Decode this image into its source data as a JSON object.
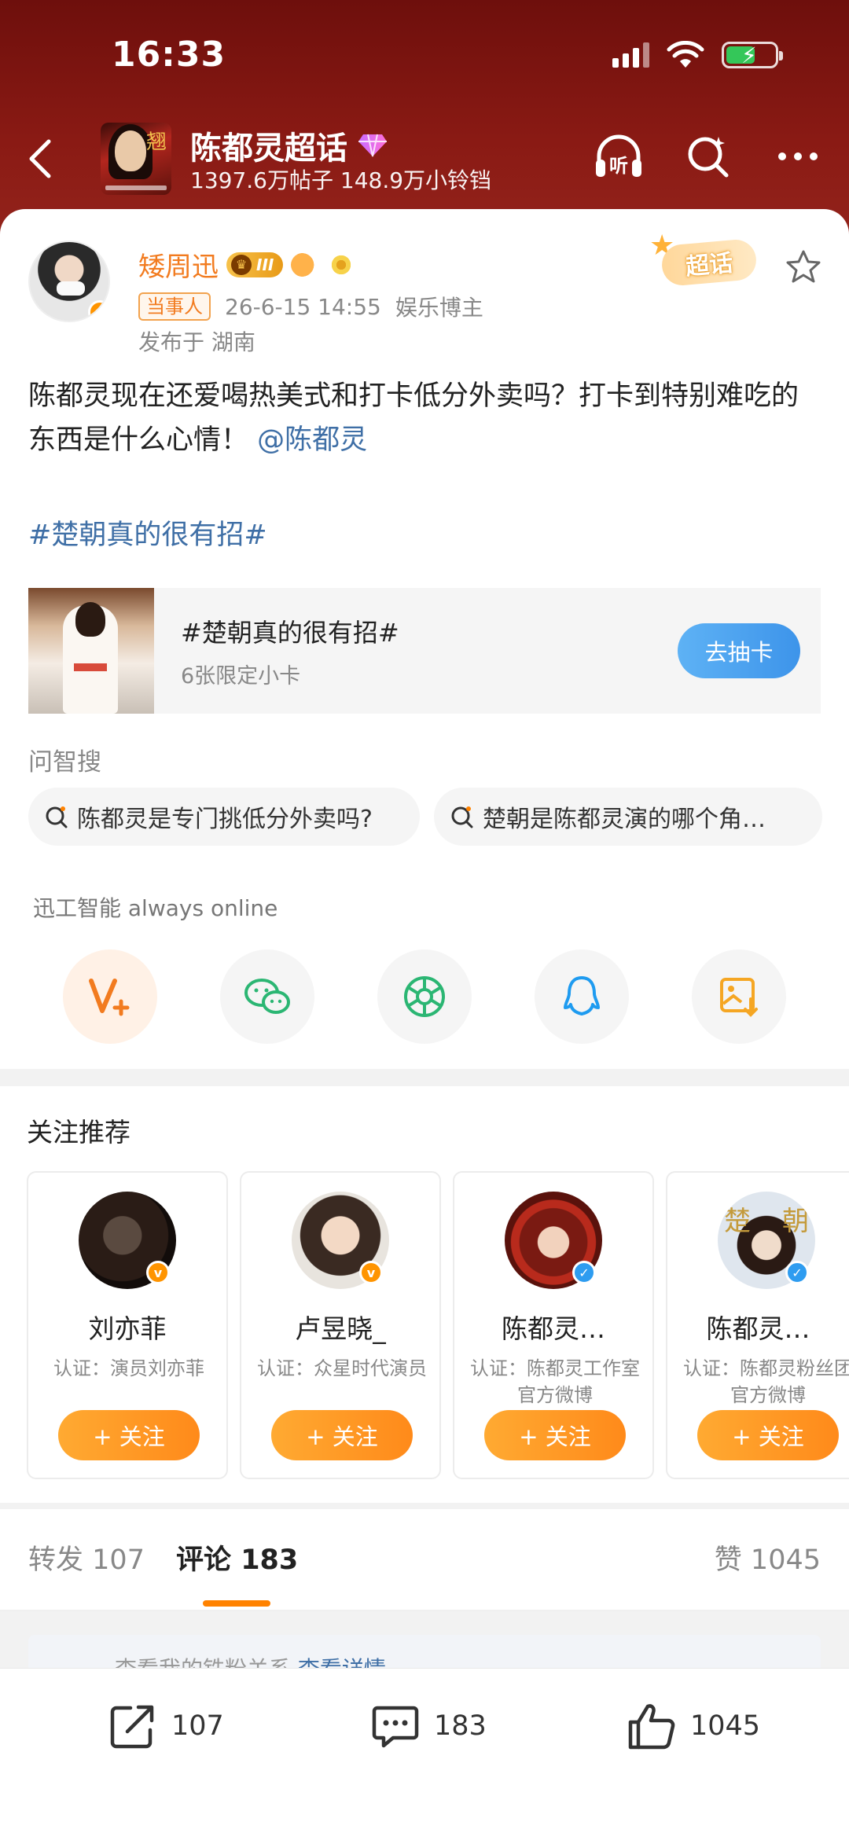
{
  "status_bar": {
    "time": "16:33"
  },
  "header": {
    "title": "陈都灵超话",
    "stats": "1397.6万帖子 148.9万小铃铛",
    "poster_glyph": "翘"
  },
  "post": {
    "username": "矮周迅",
    "level": "III",
    "role_tag": "当事人",
    "timestamp": "26-6-15 14:55",
    "author_type": "娱乐博主",
    "location": "发布于 湖南",
    "super_tag": "超话",
    "text": "陈都灵现在还爱喝热美式和打卡低分外卖吗？打卡到特别难吃的东西是什么心情！",
    "mention": "@陈都灵",
    "hashtag": "#楚朝真的很有招#",
    "topic_card": {
      "title": "#楚朝真的很有招#",
      "subtitle": "6张限定小卡",
      "button": "去抽卡"
    },
    "ask_label": "问智搜",
    "ask_chips": [
      "陈都灵是专门挑低分外卖吗?",
      "楚朝是陈都灵演的哪个角…"
    ],
    "ai_label": "迅工智能 always online",
    "share_icons": [
      "vplus-icon",
      "wechat-icon",
      "moments-icon",
      "qq-icon",
      "save-image-icon"
    ]
  },
  "recommend": {
    "title": "关注推荐",
    "follow_label": "+ 关注",
    "users": [
      {
        "name": "刘亦菲",
        "verify": "认证：演员刘亦菲",
        "badge": "orange"
      },
      {
        "name": "卢昱晓_",
        "verify": "认证：众星时代演员",
        "badge": "orange"
      },
      {
        "name": "陈都灵…",
        "verify": "认证：陈都灵工作室官方微博",
        "badge": "blue"
      },
      {
        "name": "陈都灵…",
        "verify": "认证：陈都灵粉丝团官方微博",
        "badge": "blue"
      }
    ]
  },
  "tabs": {
    "repost_label": "转发",
    "repost_count": "107",
    "comment_label": "评论",
    "comment_count": "183",
    "like_label": "赞",
    "like_count": "1045"
  },
  "notice": {
    "text": "查看我的铁粉关系 ",
    "link": "查看详情"
  },
  "bottom_bar": {
    "repost": "107",
    "comment": "183",
    "like": "1045"
  },
  "colors": {
    "header_red": "#8a1a14",
    "accent_orange": "#ff8200",
    "link_blue": "#3f6fa6"
  }
}
